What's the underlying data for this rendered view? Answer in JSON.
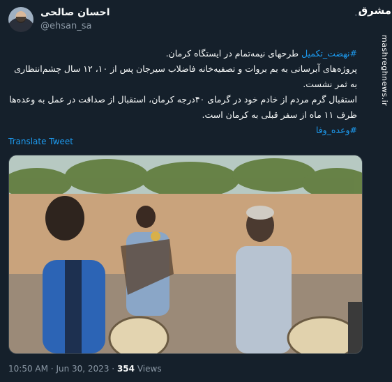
{
  "author": {
    "display_name": "احسان صالحی",
    "handle": "@ehsan_sa"
  },
  "tweet": {
    "line1_hashtag": "#نهضت_تکمیل",
    "line1_text": " طرحهای نیمه‌تمام در ایستگاه کرمان.",
    "line2_text": "پروژه‌های آبرسانی به بم بروات و تصفیه‌خانه فاضلاب سیرجان پس از ۱۰، ۱۲ سال چشم‌انتظاری به ثمر نشست.",
    "line3_text": "استقبال گرم مردم از خادم خود در گرمای ۴۰درجه کرمان، استقبال از صداقت در عمل به وعده‌ها ظرف ۱۱ ماه از سفر قبلی به کرمان است.",
    "line4_hashtag": "#وعده_وفا"
  },
  "translate_label": "Translate Tweet",
  "meta": {
    "time": "10:50 AM",
    "separator": "·",
    "date": "Jun 30, 2023",
    "views_count": "354",
    "views_label": "Views"
  },
  "watermark": {
    "logo_text": "مشرق",
    "site_text": "mashreghnews.ir"
  },
  "more_icon": "more-dots-icon",
  "colors": {
    "background": "#15202b",
    "text": "#f7f9f9",
    "secondary": "#8b98a5",
    "link": "#1d9bf0"
  }
}
